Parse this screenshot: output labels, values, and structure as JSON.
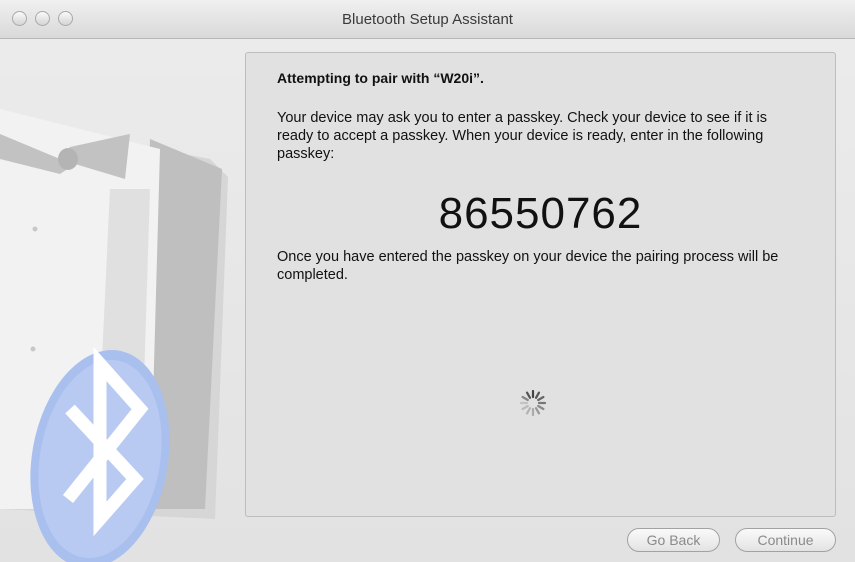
{
  "window": {
    "title": "Bluetooth Setup Assistant"
  },
  "panel": {
    "heading": "Attempting to pair with “W20i”.",
    "description": "Your device may ask you to enter a passkey. Check your device to see if it is ready to accept a passkey. When your device is ready, enter in the following passkey:",
    "passkey": "86550762",
    "note": "Once you have entered the passkey on your device the pairing process will be completed."
  },
  "buttons": {
    "back": "Go Back",
    "continue": "Continue"
  },
  "icons": {
    "illustration": "bluetooth-butler-illustration",
    "spinner": "progress-spinner-icon"
  }
}
